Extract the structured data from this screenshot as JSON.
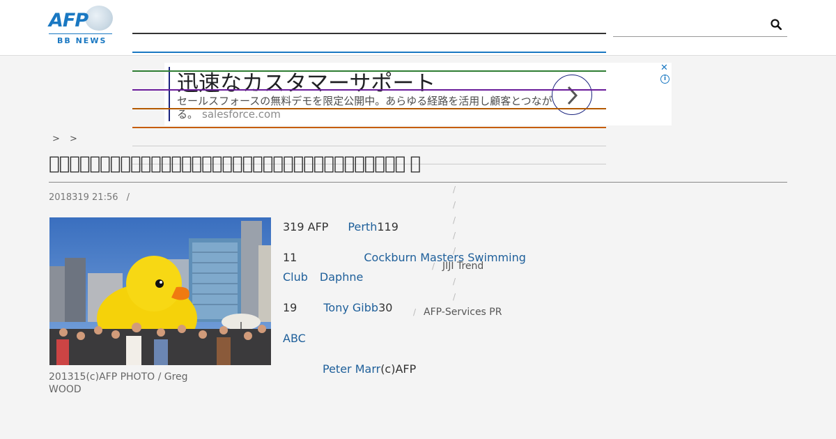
{
  "logo": {
    "name": "AFP",
    "subtitle": "BB NEWS"
  },
  "header": {
    "search_icon": "search-icon"
  },
  "colors": {
    "brand": "#1a78c2",
    "nav_lines": [
      "#333333",
      "#1a78c2",
      "#2e7d32",
      "#6a1b9a",
      "#b35900",
      "#c65d00",
      "#cccccc",
      "#cccccc"
    ]
  },
  "ad": {
    "title": "迅速なカスタマーサポート",
    "description": "セールスフォースの無料デモを限定公開中。あらゆる経路を活用し顧客とつながる。",
    "domain": "salesforce.com",
    "close_label": "✕",
    "info_label": "i"
  },
  "breadcrumb": [
    ">",
    ">"
  ],
  "article": {
    "title": " ",
    "date": "2018319 21:56",
    "date_sep": "/",
    "caption": "201315(c)AFP PHOTO / Greg WOOD",
    "lines": [
      {
        "text1": "319 AFP",
        "link": "Perth",
        "text2": "119"
      },
      {
        "text1": "11",
        "link": "Cockburn Masters Swimming",
        "text2": ""
      },
      {
        "text1": "",
        "link": "Club",
        "text2": ""
      },
      {
        "text1": "",
        "link": "Daphne",
        "text2": ""
      },
      {
        "text1": "19",
        "link": "Tony Gibb",
        "text2": "30"
      },
      {
        "text1": "",
        "link": "ABC",
        "text2": ""
      },
      {
        "text1": "",
        "link": "Peter Marr",
        "text2": "(c)AFP"
      }
    ]
  },
  "sidebar": {
    "slash": "/",
    "items": [
      "JIJI Trend",
      "AFP-Services PR"
    ]
  }
}
